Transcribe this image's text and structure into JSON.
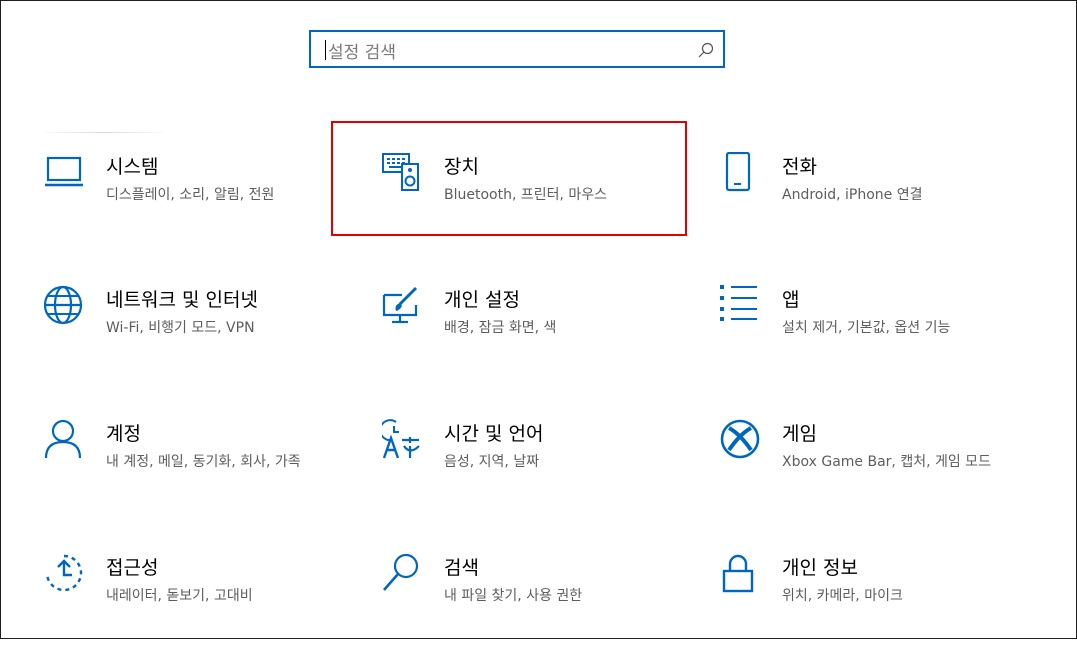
{
  "search": {
    "placeholder": "설정 검색"
  },
  "tiles": [
    {
      "title": "시스템",
      "desc": "디스플레이, 소리, 알림, 전원"
    },
    {
      "title": "장치",
      "desc": "Bluetooth, 프린터, 마우스"
    },
    {
      "title": "전화",
      "desc": "Android, iPhone 연결"
    },
    {
      "title": "네트워크 및 인터넷",
      "desc": "Wi-Fi, 비행기 모드, VPN"
    },
    {
      "title": "개인 설정",
      "desc": "배경, 잠금 화면, 색"
    },
    {
      "title": "앱",
      "desc": "설치 제거, 기본값, 옵션 기능"
    },
    {
      "title": "계정",
      "desc": "내 계정, 메일, 동기화, 회사, 가족"
    },
    {
      "title": "시간 및 언어",
      "desc": "음성, 지역, 날짜"
    },
    {
      "title": "게임",
      "desc": "Xbox Game Bar, 캡처, 게임 모드"
    },
    {
      "title": "접근성",
      "desc": "내레이터, 돋보기, 고대비"
    },
    {
      "title": "검색",
      "desc": "내 파일 찾기, 사용 권한"
    },
    {
      "title": "개인 정보",
      "desc": "위치, 카메라, 마이크"
    }
  ],
  "colors": {
    "accent": "#0067c0",
    "highlight": "#e00000"
  }
}
